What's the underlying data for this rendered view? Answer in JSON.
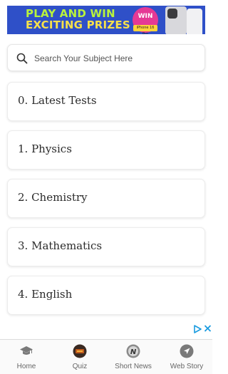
{
  "banner": {
    "line1": "PLAY AND WIN",
    "line2": "EXCITING PRIZES",
    "badge": "WIN",
    "badge_sub": "iPhone 16 Pro",
    "bg_color": "#2f50c8"
  },
  "search": {
    "placeholder": "Search Your Subject Here",
    "value": ""
  },
  "subjects": [
    {
      "label": "0. Latest Tests"
    },
    {
      "label": "1. Physics"
    },
    {
      "label": "2. Chemistry"
    },
    {
      "label": "3. Mathematics"
    },
    {
      "label": "4. English"
    }
  ],
  "bottom_nav": {
    "items": [
      {
        "label": "Home",
        "icon": "graduation-cap-icon"
      },
      {
        "label": "Quiz",
        "icon": "quiz-icon"
      },
      {
        "label": "Short News",
        "icon": "news-icon"
      },
      {
        "label": "Web Story",
        "icon": "web-story-icon"
      }
    ]
  },
  "colors": {
    "ad_choices": "#1a9bdf",
    "nav_icon": "#7a7a7a",
    "quiz_icon": "#c05a1c"
  }
}
